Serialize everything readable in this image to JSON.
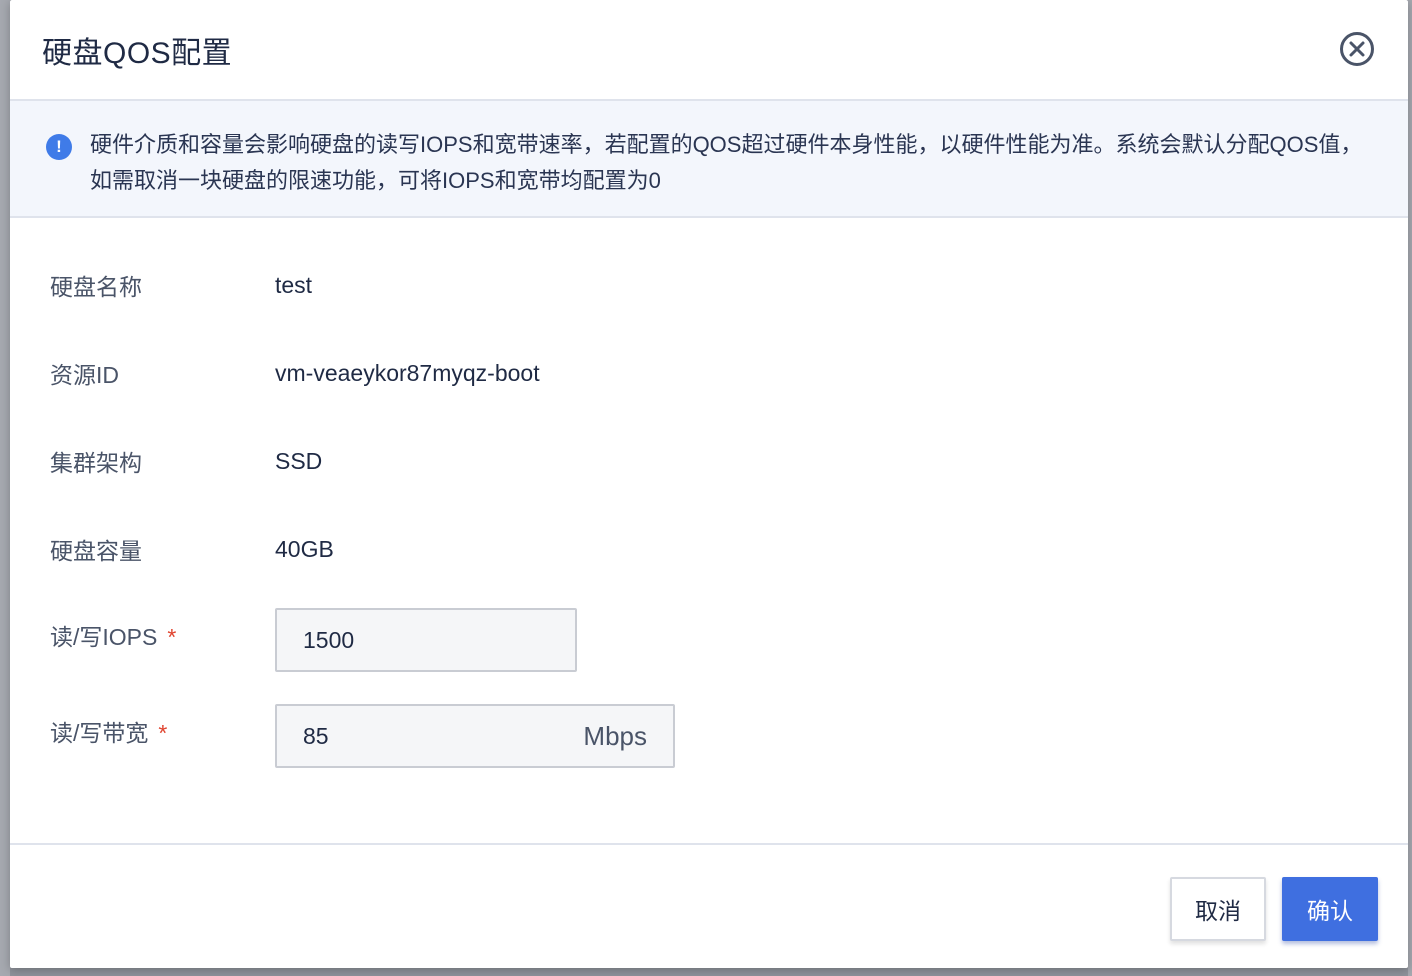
{
  "dialog": {
    "title": "硬盘QOS配置",
    "notice": "硬件介质和容量会影响硬盘的读写IOPS和宽带速率，若配置的QOS超过硬件本身性能，以硬件性能为准。系统会默认分配QOS值，如需取消一块硬盘的限速功能，可将IOPS和宽带均配置为0"
  },
  "form": {
    "disk_name_label": "硬盘名称",
    "disk_name_value": "test",
    "resource_id_label": "资源ID",
    "resource_id_value": "vm-veaeykor87myqz-boot",
    "cluster_label": "集群架构",
    "cluster_value": "SSD",
    "capacity_label": "硬盘容量",
    "capacity_value": "40GB",
    "iops_label": "读/写IOPS",
    "iops_value": "1500",
    "bandwidth_label": "读/写带宽",
    "bandwidth_value": "85",
    "bandwidth_unit": "Mbps",
    "required_mark": "*"
  },
  "footer": {
    "cancel_label": "取消",
    "confirm_label": "确认"
  },
  "colors": {
    "primary": "#3f6fe0",
    "info_icon": "#3f7be8",
    "required": "#e0442f"
  },
  "icons": {
    "close": "close-circle-icon",
    "info": "info-circle-icon"
  }
}
